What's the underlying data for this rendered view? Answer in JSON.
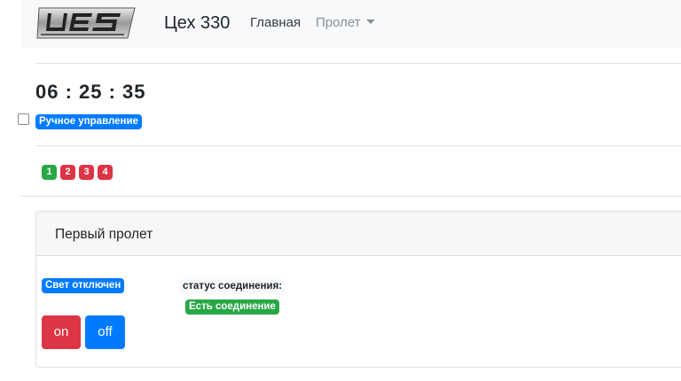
{
  "navbar": {
    "brand": "Цех 330",
    "home_link": "Главная",
    "dropdown_label": "Пролет",
    "logo": "ЦЭЗ"
  },
  "status": {
    "time": "06 : 25 : 35",
    "manual_control_label": "Ручное управление",
    "manual_control_checked": false
  },
  "spans": [
    {
      "label": "1",
      "state": "success"
    },
    {
      "label": "2",
      "state": "danger"
    },
    {
      "label": "3",
      "state": "danger"
    },
    {
      "label": "4",
      "state": "danger"
    }
  ],
  "panel": {
    "title": "Первый пролет",
    "light_status": "Свет отключен",
    "connection_label": "статус соединения:",
    "connection_status": "Есть соединение",
    "on_button": "on",
    "off_button": "off"
  },
  "colors": {
    "primary": "#007bff",
    "success": "#28a745",
    "danger": "#dc3545",
    "navbar_bg": "#f8f9fa"
  }
}
